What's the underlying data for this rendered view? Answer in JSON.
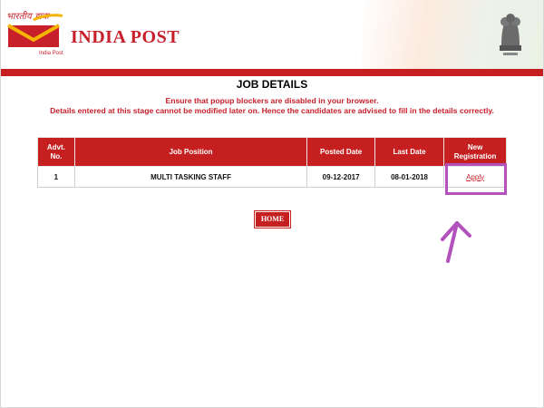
{
  "header": {
    "hindi_text": "भारतीय डाक",
    "logo_subtext": "India Post",
    "brand": "INDIA POST",
    "brand_color": "#c8202b"
  },
  "page": {
    "title": "JOB DETAILS",
    "notice_line1": "Ensure that popup blockers are disabled in your browser.",
    "notice_line2": "Details entered at this stage cannot be modified later on. Hence the candidates are advised to fill in the details correctly."
  },
  "table": {
    "columns": [
      "Advt.\nNo.",
      "Job Position",
      "Posted Date",
      "Last Date",
      "New\nRegistration"
    ],
    "rows": [
      {
        "advt_no": "1",
        "job_position": "MULTI TASKING STAFF",
        "posted_date": "09-12-2017",
        "last_date": "08-01-2018",
        "action": "Apply"
      }
    ]
  },
  "home_button": "HOME",
  "colors": {
    "header_bar": "#c5201f",
    "highlight": "#b351bd"
  }
}
